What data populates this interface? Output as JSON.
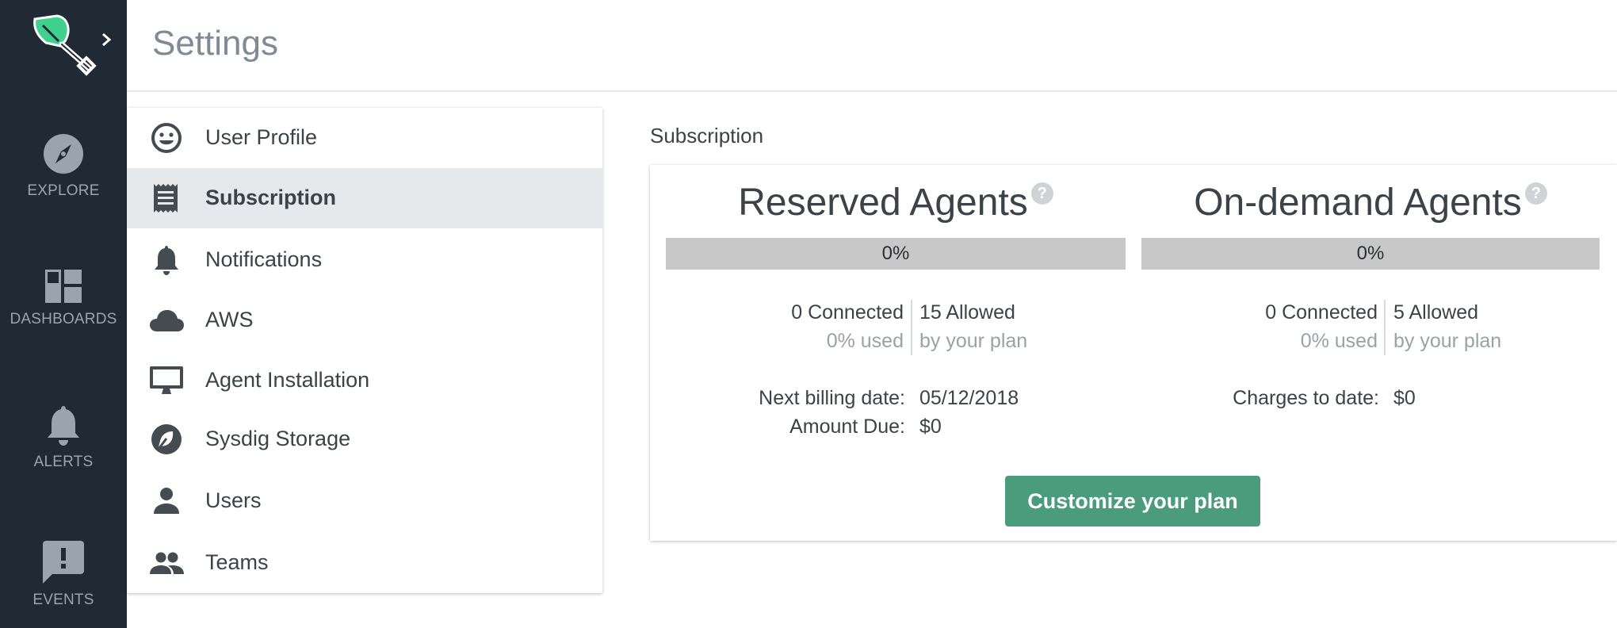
{
  "app": {
    "colors": {
      "nav_bg": "#1f2a35",
      "accent": "#4a9c7d",
      "logo": "#3fd18d"
    }
  },
  "nav": {
    "items": [
      {
        "label": "EXPLORE",
        "icon": "compass-icon"
      },
      {
        "label": "DASHBOARDS",
        "icon": "dashboard-icon"
      },
      {
        "label": "ALERTS",
        "icon": "bell-icon"
      },
      {
        "label": "EVENTS",
        "icon": "event-icon"
      }
    ]
  },
  "header": {
    "title": "Settings"
  },
  "settings_menu": {
    "items": [
      {
        "label": "User Profile",
        "icon": "smiley-icon",
        "active": false
      },
      {
        "label": "Subscription",
        "icon": "receipt-icon",
        "active": true
      },
      {
        "label": "Notifications",
        "icon": "bell-icon",
        "active": false
      },
      {
        "label": "AWS",
        "icon": "cloud-icon",
        "active": false
      },
      {
        "label": "Agent Installation",
        "icon": "monitor-icon",
        "active": false
      },
      {
        "label": "Sysdig Storage",
        "icon": "storage-icon",
        "active": false
      },
      {
        "label": "Users",
        "icon": "user-icon",
        "active": false
      },
      {
        "label": "Teams",
        "icon": "team-icon",
        "active": false
      }
    ]
  },
  "subscription": {
    "section_title": "Subscription",
    "reserved": {
      "title": "Reserved Agents",
      "help": "?",
      "progress_percent": 0,
      "progress_text": "0%",
      "connected": "0 Connected",
      "used": "0% used",
      "allowed": "15 Allowed",
      "allowed_sub": "by your plan",
      "billing_label": "Next billing date:",
      "billing_value": "05/12/2018",
      "amount_label": "Amount Due:",
      "amount_value": "$0"
    },
    "ondemand": {
      "title": "On-demand Agents",
      "help": "?",
      "progress_percent": 0,
      "progress_text": "0%",
      "connected": "0 Connected",
      "used": "0% used",
      "allowed": "5 Allowed",
      "allowed_sub": "by your plan",
      "charges_label": "Charges to date:",
      "charges_value": "$0"
    },
    "customize_label": "Customize your plan"
  }
}
